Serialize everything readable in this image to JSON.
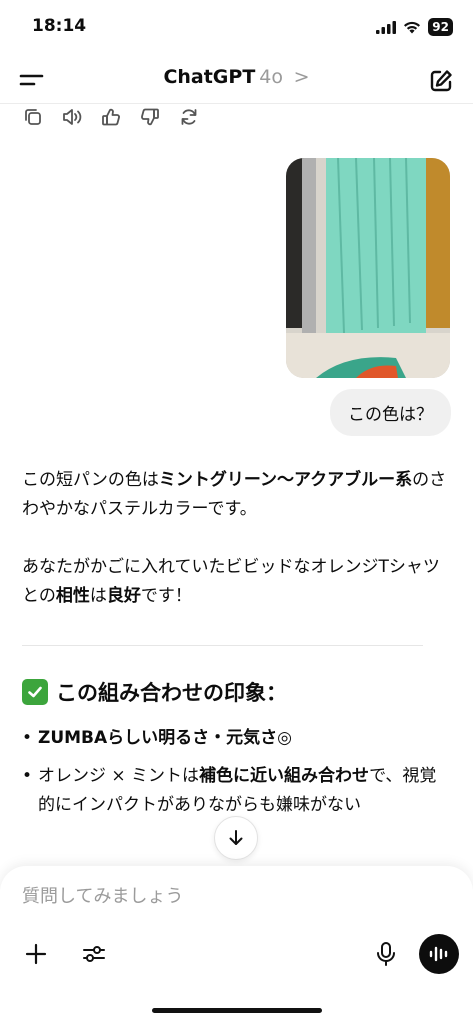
{
  "status_bar": {
    "time": "18:14",
    "battery": "92"
  },
  "header": {
    "title": "ChatGPT",
    "model": "4o",
    "chevron": ">"
  },
  "user_message": {
    "text": "この色は？"
  },
  "assistant": {
    "p1_a": "この短パンの色は",
    "p1_b": "ミントグリーン〜アクアブルー系",
    "p1_c": "のさわやかなパステルカラーです。",
    "p2_a": "あなたがかごに入れていたビビッドなオレンジTシャツとの",
    "p2_b": "相性",
    "p2_c": "は",
    "p2_d": "良好",
    "p2_e": "です！",
    "section_title": "この組み合わせの印象：",
    "bullet1_a": "ZUMBAらしい明るさ・元気さ",
    "bullet1_b": "◎",
    "bullet2_a": "オレンジ × ミントは",
    "bullet2_b": "補色に近い組み合わせ",
    "bullet2_c": "で、視覚的にインパクトがありながらも嫌味がない"
  },
  "composer": {
    "placeholder": "質問してみましょう"
  },
  "icons": {
    "menu": "menu-icon",
    "new_chat": "edit-icon",
    "copy": "copy-icon",
    "speaker": "speaker-icon",
    "thumbs_up": "thumbs-up-icon",
    "thumbs_down": "thumbs-down-icon",
    "regenerate": "refresh-icon",
    "scroll_down": "arrow-down-icon",
    "add": "plus-icon",
    "tools": "sliders-icon",
    "mic": "mic-icon",
    "voice": "voice-wave-icon"
  },
  "colors": {
    "check_green": "#3ca53c",
    "user_bubble": "#f0f0f0"
  }
}
